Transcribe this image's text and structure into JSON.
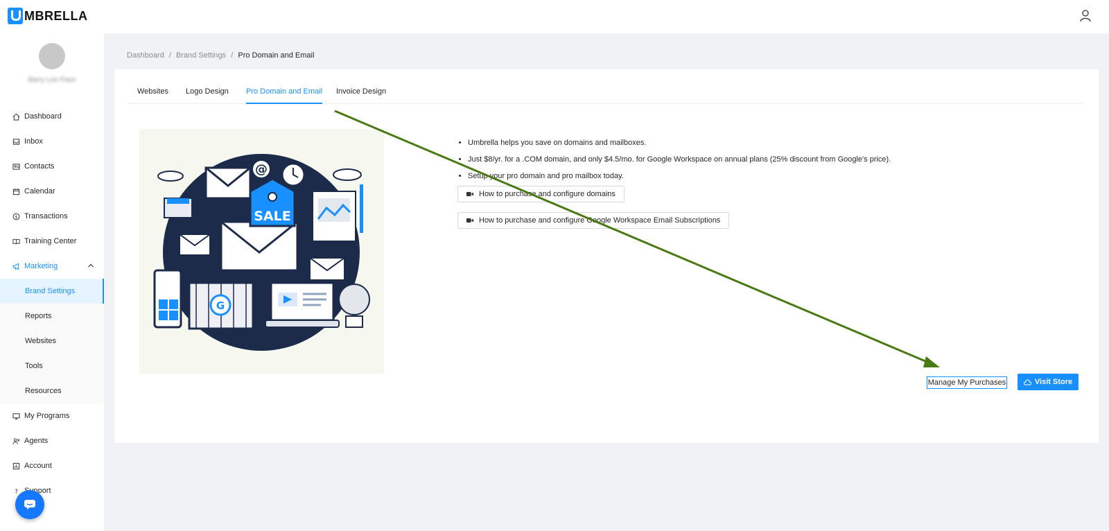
{
  "app": {
    "name": "MBRELLA",
    "logo_letter": "U"
  },
  "header": {
    "user_icon": "user-icon"
  },
  "sidebar": {
    "user_name": "Barry Lee Pace",
    "items": [
      {
        "label": "Dashboard",
        "icon": "home-icon"
      },
      {
        "label": "Inbox",
        "icon": "inbox-icon"
      },
      {
        "label": "Contacts",
        "icon": "contacts-icon"
      },
      {
        "label": "Calendar",
        "icon": "calendar-icon"
      },
      {
        "label": "Transactions",
        "icon": "dollar-icon"
      },
      {
        "label": "Training Center",
        "icon": "book-icon"
      },
      {
        "label": "Marketing",
        "icon": "megaphone-icon"
      }
    ],
    "marketing_sub": [
      {
        "label": "Brand Settings"
      },
      {
        "label": "Reports"
      },
      {
        "label": "Websites"
      },
      {
        "label": "Tools"
      },
      {
        "label": "Resources"
      }
    ],
    "items_after": [
      {
        "label": "My Programs",
        "icon": "monitor-icon"
      },
      {
        "label": "Agents",
        "icon": "agents-icon"
      },
      {
        "label": "Account",
        "icon": "account-icon"
      },
      {
        "label": "Support",
        "icon": "question-icon"
      }
    ]
  },
  "breadcrumb": {
    "items": [
      "Dashboard",
      "Brand Settings",
      "Pro Domain and Email"
    ],
    "separator": "/"
  },
  "tabs": [
    {
      "label": "Websites"
    },
    {
      "label": "Logo Design"
    },
    {
      "label": "Pro Domain and Email",
      "active": true
    },
    {
      "label": "Invoice Design"
    }
  ],
  "illustration": {
    "sale_text": "SALE",
    "g_letter": "G",
    "at_symbol": "@"
  },
  "info": {
    "bullets": [
      "Umbrella helps you save on domains and mailboxes.",
      "Just $8/yr. for a .COM domain, and only $4.5/mo. for Google Workspace on annual plans (25% discount from Google's price).",
      "Setup your pro domain and pro mailbox today."
    ],
    "video_buttons": [
      "How to purchase and configure domains",
      "How to purchase and configure Google Workspace Email Subscriptions"
    ]
  },
  "actions": {
    "manage_label": "Manage My Purchases",
    "visit_label": "Visit Store"
  },
  "colors": {
    "primary": "#1890ff",
    "arrow": "#4a7a14",
    "illustration_navy": "#1c2b4a"
  }
}
